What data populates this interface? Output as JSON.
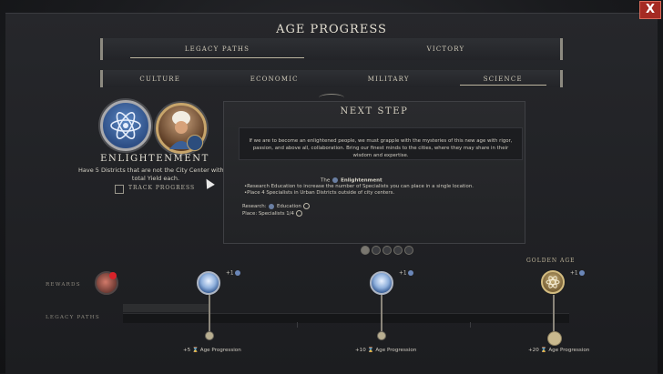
{
  "title": "AGE PROGRESS",
  "close_label": "X",
  "top_tabs": [
    {
      "label": "LEGACY PATHS",
      "active": true
    },
    {
      "label": "VICTORY",
      "active": false
    }
  ],
  "sub_tabs": [
    {
      "label": "CULTURE",
      "active": false
    },
    {
      "label": "ECONOMIC",
      "active": false
    },
    {
      "label": "MILITARY",
      "active": false
    },
    {
      "label": "SCIENCE",
      "active": true
    }
  ],
  "objective": {
    "name": "ENLIGHTENMENT",
    "description": "Have 5 Districts that are not the City Center with 40 total Yield each.",
    "track_label": "TRACK PROGRESS"
  },
  "next_step": {
    "title": "NEXT STEP",
    "quote": "If we are to become an enlightened people, we must grapple with the mysteries of this new age with rigor, passion, and above all, collaboration. Bring our finest minds to the cities, where they may share in their wisdom and expertise.",
    "heading_prefix": "The",
    "heading": "Enlightenment",
    "bullets": [
      "•Research Education to increase the number of Specialists you can place in a single location.",
      "•Place 4 Specialists in Urban Districts outside of city centers."
    ],
    "research_label": "Research:",
    "research_value": "Education",
    "place_label": "Place:",
    "place_value": "Specialists 1/4"
  },
  "pagination": {
    "count": 5,
    "active_index": 0
  },
  "timeline": {
    "rewards_label": "REWARDS",
    "legacy_label": "LEGACY PATHS",
    "golden_age_label": "GOLDEN AGE",
    "milestones": [
      {
        "reward": "+1",
        "progress_text": "+5",
        "label": "Age Progression"
      },
      {
        "reward": "+1",
        "progress_text": "+10",
        "label": "Age Progression"
      },
      {
        "reward": "+1",
        "progress_text": "+20",
        "label": "Age Progression"
      }
    ]
  },
  "colors": {
    "accent_gold": "#c7a56b",
    "science_blue": "#3b5f96",
    "close_red": "#a52b23"
  }
}
